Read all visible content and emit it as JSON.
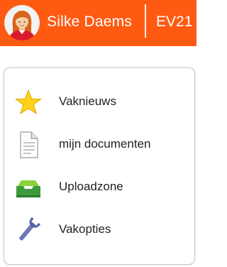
{
  "header": {
    "user_name": "Silke Daems",
    "code": "EV21",
    "background_color": "#ff5a12"
  },
  "menu": {
    "items": [
      {
        "label": "Vaknieuws",
        "icon": "star-icon"
      },
      {
        "label": "mijn documenten",
        "icon": "document-icon"
      },
      {
        "label": "Uploadzone",
        "icon": "inbox-tray-icon"
      },
      {
        "label": "Vakopties",
        "icon": "wrench-icon"
      }
    ]
  }
}
